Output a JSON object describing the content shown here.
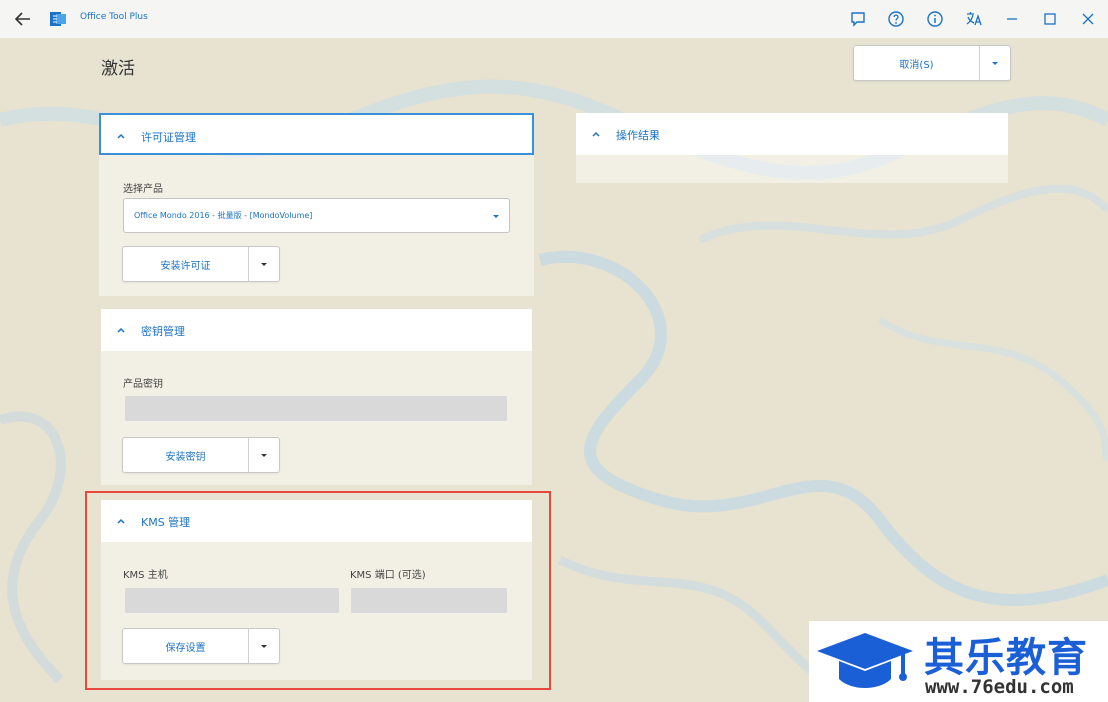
{
  "window": {
    "title": "Office Tool Plus"
  },
  "page": {
    "title": "激活"
  },
  "top_action": {
    "label": "取消(S)"
  },
  "license_section": {
    "title": "许可证管理",
    "product_label": "选择产品",
    "product_value": "Office Mondo 2016 - 批量版 - [MondoVolume]",
    "install_label": "安装许可证"
  },
  "key_section": {
    "title": "密钥管理",
    "key_label": "产品密钥",
    "key_value": "",
    "install_label": "安装密钥"
  },
  "kms_section": {
    "title": "KMS 管理",
    "host_label": "KMS 主机",
    "host_value": "",
    "port_label": "KMS 端口 (可选)",
    "port_value": "",
    "save_label": "保存设置"
  },
  "result_section": {
    "title": "操作结果"
  },
  "watermark": {
    "title": "其乐教育",
    "url": "www.76edu.com"
  },
  "colors": {
    "accent": "#1a73c6",
    "highlight": "#e8473b",
    "watermark": "#1b5fd6"
  }
}
